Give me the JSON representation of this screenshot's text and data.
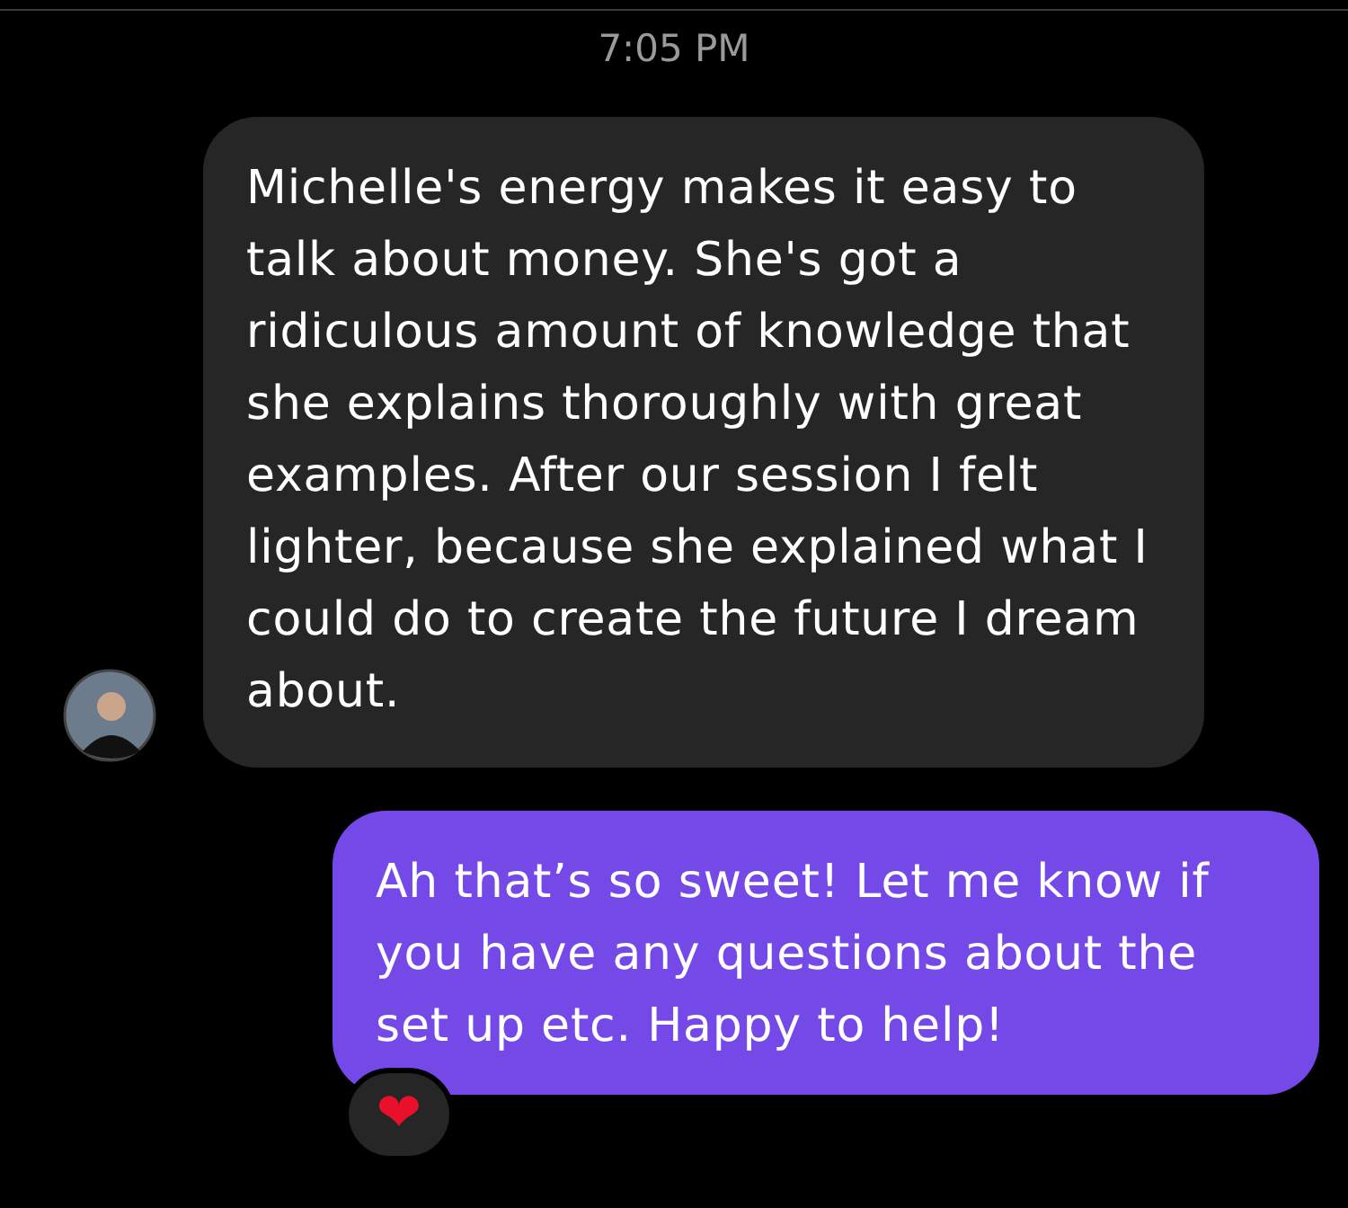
{
  "timestamp": "7:05 PM",
  "messages": [
    {
      "kind": "received",
      "text": "Michelle's energy makes it easy to talk about money. She's got a ridiculous amount of knowledge that she explains thoroughly with great examples. After our session I felt lighter, because she explained what I could do to create the future I dream about.",
      "avatar": true
    },
    {
      "kind": "sent",
      "text": "Ah that’s so sweet! Let me know if you have any questions about the set up etc. Happy to help!",
      "reaction": "❤"
    }
  ]
}
